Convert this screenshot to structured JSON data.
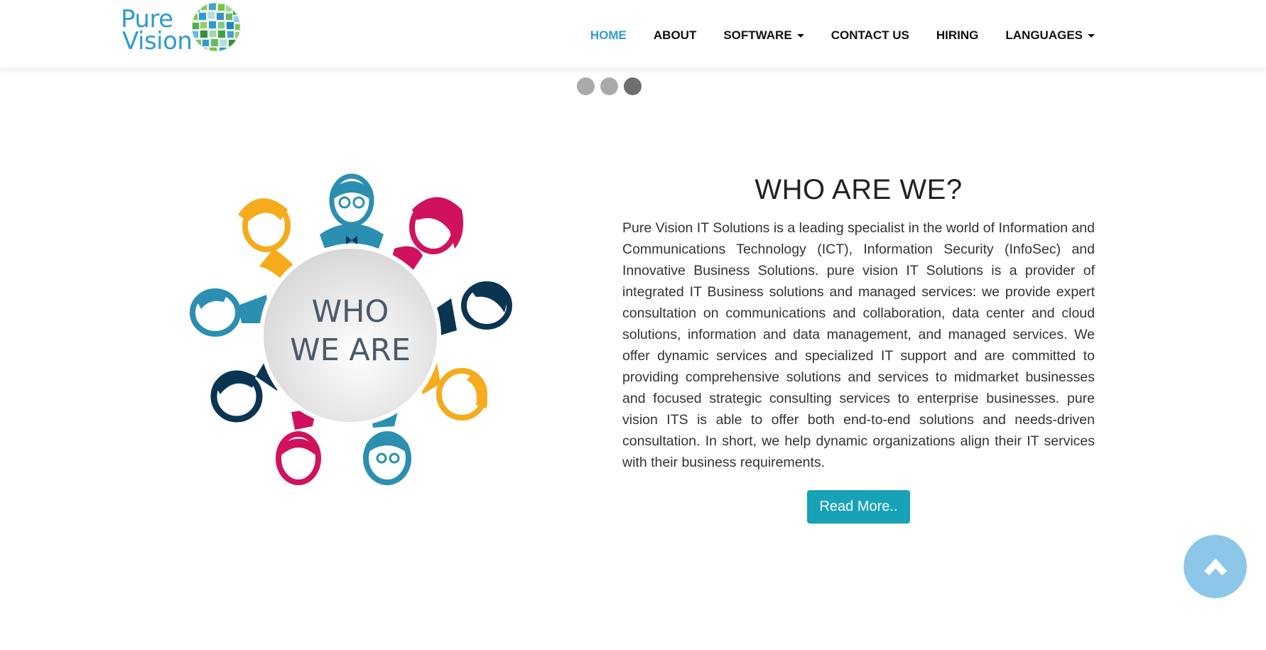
{
  "brand": {
    "line1": "Pure",
    "line2": "Vision",
    "colors": {
      "primary": "#2e9bd0",
      "button": "#17a2b8",
      "to_top": "#8cc7ea"
    }
  },
  "nav": {
    "items": [
      {
        "label": "HOME",
        "active": true
      },
      {
        "label": "ABOUT"
      },
      {
        "label": "SOFTWARE",
        "dropdown": true
      },
      {
        "label": "CONTACT US"
      },
      {
        "label": "HIRING"
      },
      {
        "label": "LANGUAGES",
        "dropdown": true
      }
    ]
  },
  "carousel": {
    "slide_count": 3,
    "active_slide": 3
  },
  "illustration": {
    "line1": "WHO",
    "line2": "WE ARE"
  },
  "about": {
    "heading": "WHO ARE WE?",
    "body": "Pure Vision IT Solutions is a leading specialist in the world of Information and Communications Technology (ICT), Information Security (InfoSec) and Innovative Business Solutions. pure vision IT Solutions is a provider of integrated IT Business solutions and managed services: we provide expert consultation on communications and collaboration, data center and cloud solutions, information and data management, and managed services. We offer dynamic services and specialized IT support and are committed to providing comprehensive solutions and services to midmarket businesses and focused strategic consulting services to enterprise businesses. pure vision ITS is able to offer both end-to-end solutions and needs-driven consultation. In short, we help dynamic organizations align their IT services with their business requirements.",
    "button": "Read More.."
  },
  "icons": {
    "scroll_top": "chevron-up-icon",
    "logo_globe": "globe-icon"
  }
}
